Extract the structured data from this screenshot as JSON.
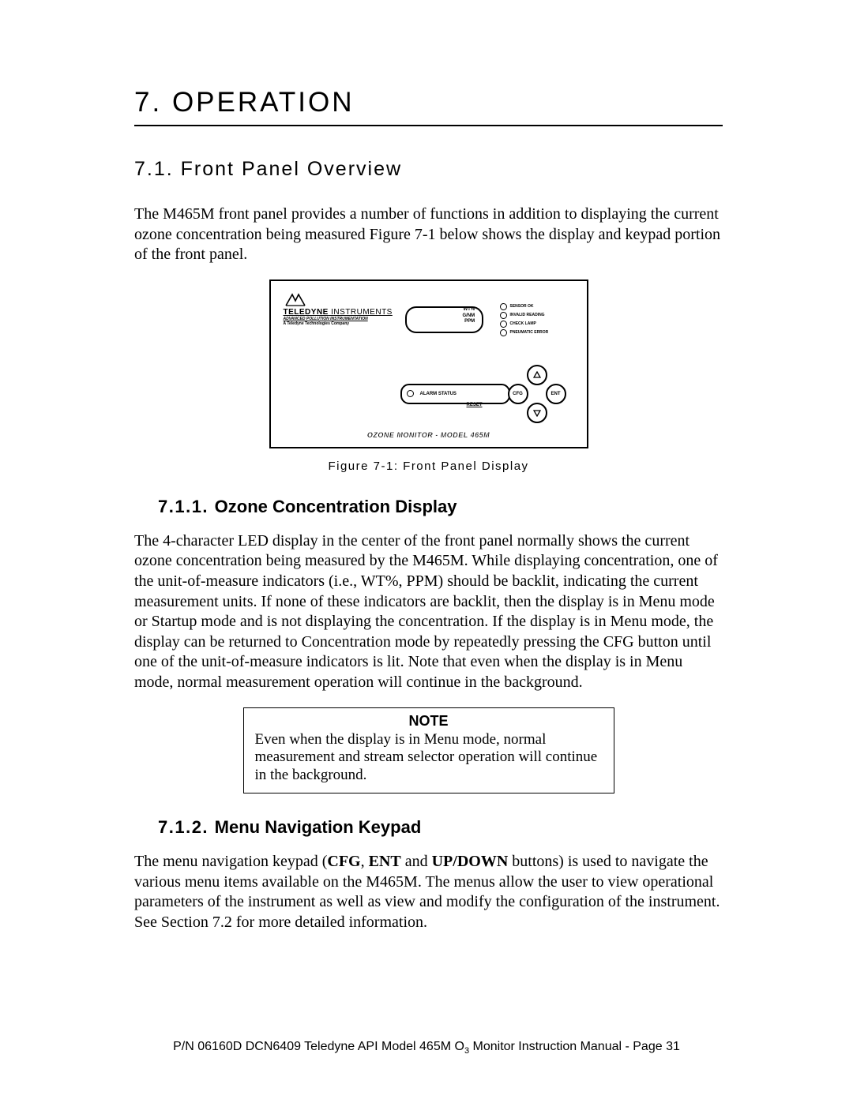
{
  "chapter": {
    "number": "7.",
    "title": "OPERATION"
  },
  "section71": {
    "number": "7.1.",
    "title": "Front Panel Overview",
    "para": "The M465M front panel provides a number of functions in addition to displaying the current ozone concentration being measured Figure 7-1 below shows the display and keypad portion of the front panel."
  },
  "figure": {
    "caption": "Figure 7-1:  Front Panel Display",
    "logo_line1a": "TELEDYNE",
    "logo_line1b": " INSTRUMENTS",
    "logo_line2": "ADVANCED POLLUTION INSTRUMENTATION",
    "logo_line3": "A Teledyne Technologies Company",
    "uom": [
      "WT%",
      "G/NM",
      "PPM"
    ],
    "leds": [
      "SENSOR OK",
      "INVALID READING",
      "CHECK LAMP",
      "PNEUMATIC ERROR"
    ],
    "alarm_label": "ALARM STATUS",
    "reset_label": "RESET",
    "keypad": {
      "cfg": "CFG",
      "ent": "ENT"
    },
    "footer": "OZONE MONITOR  -  MODEL 465M"
  },
  "section711": {
    "number": "7.1.1.",
    "title": "Ozone Concentration Display",
    "para": "The 4-character LED display in the center of the front panel normally shows the current ozone concentration being measured by the M465M.  While displaying concentration, one of the unit-of-measure indicators (i.e., WT%, PPM) should be backlit, indicating the current measurement units.  If none of these indicators are backlit, then the display is in Menu mode or Startup mode and is not displaying the concentration.  If the display is in Menu mode, the display can be returned to Concentration mode by repeatedly pressing the CFG button until one of the unit-of-measure indicators is lit.  Note that even when the display is in Menu mode, normal measurement operation will continue in the background."
  },
  "note": {
    "title": "NOTE",
    "body": "Even when the display is in Menu mode, normal measurement and stream selector operation will continue in the background."
  },
  "section712": {
    "number": "7.1.2.",
    "title": "Menu Navigation Keypad",
    "para_pre": "The menu navigation keypad (",
    "b1": "CFG",
    "sep1": ", ",
    "b2": "ENT",
    "sep2": " and ",
    "b3": "UP/DOWN",
    "para_post": " buttons) is used to navigate the various menu items available on the M465M.  The menus allow the user to view operational parameters of the instrument as well as view and modify the configuration of the instrument.  See Section 7.2 for more detailed information."
  },
  "footer": {
    "pre": "P/N 06160D DCN6409 Teledyne API Model 465M O",
    "sub": "3",
    "post": " Monitor Instruction Manual - Page 31"
  }
}
